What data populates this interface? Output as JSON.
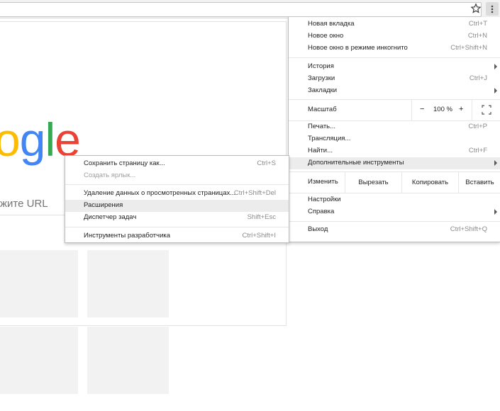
{
  "page": {
    "logo_letters": [
      {
        "ch": "o",
        "color": "#fbbc05"
      },
      {
        "ch": "g",
        "color": "#4285f4"
      },
      {
        "ch": "l",
        "color": "#34a853"
      },
      {
        "ch": "e",
        "color": "#ea4335"
      }
    ],
    "search_hint": "жите URL"
  },
  "main_menu": {
    "items_top": [
      {
        "label": "Новая вкладка",
        "shortcut": "Ctrl+T"
      },
      {
        "label": "Новое окно",
        "shortcut": "Ctrl+N"
      },
      {
        "label": "Новое окно в режиме инкогнито",
        "shortcut": "Ctrl+Shift+N"
      }
    ],
    "items_history": [
      {
        "label": "История",
        "shortcut": ""
      },
      {
        "label": "Загрузки",
        "shortcut": "Ctrl+J"
      },
      {
        "label": "Закладки",
        "shortcut": ""
      }
    ],
    "zoom": {
      "label": "Масштаб",
      "minus": "−",
      "value": "100 %",
      "plus": "+"
    },
    "items_tools": [
      {
        "label": "Печать...",
        "shortcut": "Ctrl+P"
      },
      {
        "label": "Трансляция...",
        "shortcut": ""
      },
      {
        "label": "Найти...",
        "shortcut": "Ctrl+F"
      },
      {
        "label": "Дополнительные инструменты",
        "shortcut": ""
      }
    ],
    "edit": {
      "label": "Изменить",
      "cut": "Вырезать",
      "copy": "Копировать",
      "paste": "Вставить"
    },
    "items_settings": [
      {
        "label": "Настройки",
        "shortcut": ""
      },
      {
        "label": "Справка",
        "shortcut": ""
      }
    ],
    "exit": {
      "label": "Выход",
      "shortcut": "Ctrl+Shift+Q"
    }
  },
  "sub_menu": {
    "items": [
      {
        "label": "Сохранить страницу как...",
        "shortcut": "Ctrl+S"
      },
      {
        "label": "Создать ярлык...",
        "shortcut": ""
      },
      {
        "label": "Удаление данных о просмотренных страницах...",
        "shortcut": "Ctrl+Shift+Del"
      },
      {
        "label": "Расширения",
        "shortcut": ""
      },
      {
        "label": "Диспетчер задач",
        "shortcut": "Shift+Esc"
      },
      {
        "label": "Инструменты разработчика",
        "shortcut": "Ctrl+Shift+I"
      }
    ]
  },
  "colors": {
    "highlight": "#ececec",
    "tile": "#f2f2f2"
  }
}
